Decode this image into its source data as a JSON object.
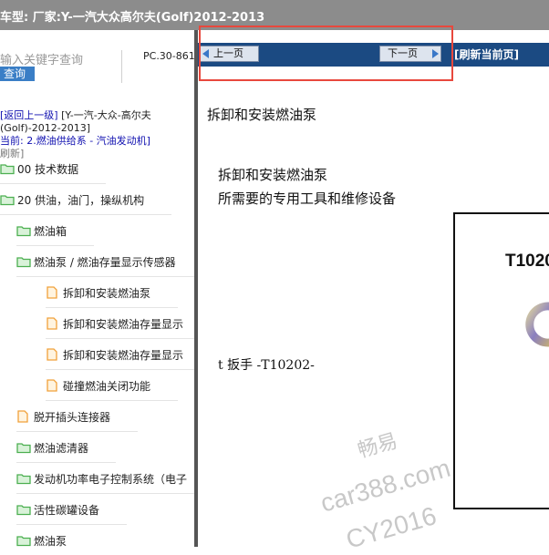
{
  "window": {
    "title": "车型:  厂家:Y-一汽大众高尔夫(Golf)2012-2013"
  },
  "search": {
    "placeholder": "输入关键字查询",
    "query_label": "查询",
    "code": "PC.30-861"
  },
  "nav": {
    "back_label": "[返回上一级]",
    "back_target": "[Y-一汽-大众-高尔夫",
    "back_target_cont": "(Golf)-2012-2013]",
    "current_prefix": "当前:",
    "current_path": "2.燃油供给系 - 汽油发动机]",
    "refresh": "刷新]"
  },
  "tree": {
    "items": [
      {
        "label": "00 技术数据",
        "icon": "folder-icon"
      },
      {
        "label": "20 供油，油门，操纵机构",
        "icon": "folder-icon"
      },
      {
        "label": "燃油箱",
        "icon": "folder-icon"
      },
      {
        "label": "燃油泵 / 燃油存量显示传感器",
        "icon": "folder-icon"
      },
      {
        "label": "拆卸和安装燃油泵",
        "icon": "document-icon"
      },
      {
        "label": "拆卸和安装燃油存量显示",
        "icon": "document-icon"
      },
      {
        "label": "拆卸和安装燃油存量显示",
        "icon": "document-icon"
      },
      {
        "label": "碰撞燃油关闭功能",
        "icon": "document-icon"
      },
      {
        "label": "脱开插头连接器",
        "icon": "document-icon"
      },
      {
        "label": "燃油滤清器",
        "icon": "folder-icon"
      },
      {
        "label": "发动机功率电子控制系统（电子",
        "icon": "folder-icon"
      },
      {
        "label": "活性碳罐设备",
        "icon": "folder-icon"
      },
      {
        "label": "燃油泵",
        "icon": "folder-icon"
      }
    ]
  },
  "toolbar": {
    "prev_label": "上一页",
    "next_label": "下一页",
    "refresh_label": "[刷新当前页]"
  },
  "content": {
    "heading": "拆卸和安装燃油泵",
    "subheading": "拆卸和安装燃油泵",
    "tools_heading": "所需要的专用工具和维修设备",
    "tool_item": "t  扳手 -T10202-",
    "tool_image_label": "T1020"
  },
  "watermark": {
    "line1": "畅易",
    "line2": "car388.com",
    "line3": "CY2016"
  },
  "colors": {
    "accent": "#1b4a82",
    "titlebar": "#8c8c8c",
    "highlight": "#e8483d",
    "folder": "#4caf50",
    "document": "#f0a13a"
  }
}
